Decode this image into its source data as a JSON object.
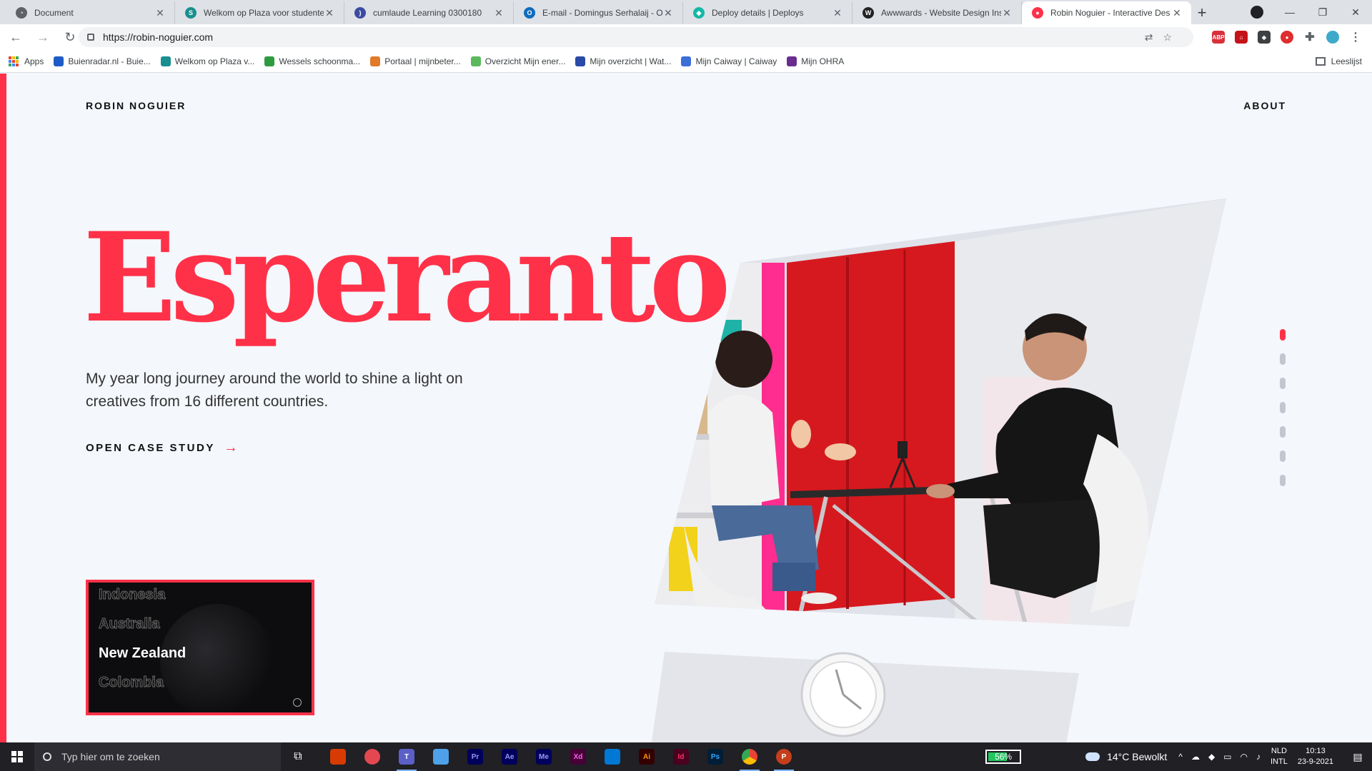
{
  "browser": {
    "tabs": [
      {
        "title": "Document",
        "fav_color": "#5f6368",
        "fav_char": "◔"
      },
      {
        "title": "Welkom op Plaza voor studente",
        "fav_color": "#1a8f8f",
        "fav_char": "S"
      },
      {
        "title": "cumlaude Learning 0300180",
        "fav_color": "#3b4ba0",
        "fav_char": ")"
      },
      {
        "title": "E-mail - Domingus Serhalaij - O",
        "fav_color": "#0f6cbd",
        "fav_char": "O"
      },
      {
        "title": "Deploy details | Deploys",
        "fav_color": "#14b8a6",
        "fav_char": "◆"
      },
      {
        "title": "Awwwards - Website Design Insp",
        "fav_color": "#222222",
        "fav_char": "W"
      },
      {
        "title": "Robin Noguier - Interactive Des",
        "fav_color": "#ff3148",
        "fav_char": "●"
      }
    ],
    "active_tab": 6,
    "new_tab_label": "+",
    "url": "https://robin-noguier.com",
    "bookmarks": [
      {
        "label": "Apps",
        "color": "#ea4335"
      },
      {
        "label": "Buienradar.nl - Buie...",
        "color": "#1e5bc6"
      },
      {
        "label": "Welkom op Plaza v...",
        "color": "#1a8f8f"
      },
      {
        "label": "Wessels schoonma...",
        "color": "#2e9b3e"
      },
      {
        "label": "Portaal | mijnbeter...",
        "color": "#e07b2a"
      },
      {
        "label": "Overzicht Mijn ener...",
        "color": "#5cb85c"
      },
      {
        "label": "Mijn overzicht | Wat...",
        "color": "#2a4aa8"
      },
      {
        "label": "Mijn Caiway | Caiway",
        "color": "#3a6fd8"
      },
      {
        "label": "Mijn OHRA",
        "color": "#6a2d8f"
      }
    ],
    "reading_list_label": "Leeslijst"
  },
  "site": {
    "brand": "ROBIN NOGUIER",
    "nav_about": "ABOUT",
    "hero_title": "Esperanto",
    "hero_subtitle": "My year long journey around the world to shine a light on creatives from 16 different countries.",
    "cta_label": "OPEN CASE STUDY",
    "accent_color": "#ff3148",
    "thumbnail": {
      "countries": [
        "Indonesia",
        "Australia",
        "New Zealand",
        "Colombia"
      ],
      "active_country": "New Zealand"
    },
    "slide_dots": {
      "count": 7,
      "active_index": 0
    }
  },
  "taskbar": {
    "search_placeholder": "Typ hier om te zoeken",
    "battery": "56%",
    "battery_level": 0.56,
    "weather": "14°C  Bewolkt",
    "lang_top": "NLD",
    "lang_bottom": "INTL",
    "time": "10:13",
    "date": "23-9-2021",
    "apps": [
      {
        "name": "office",
        "label": "",
        "bg": "#d83b01",
        "fg": "#fff"
      },
      {
        "name": "creative-cloud",
        "label": "",
        "bg": "#e34850",
        "fg": "#fff"
      },
      {
        "name": "teams",
        "label": "T",
        "bg": "#5b5fc7",
        "fg": "#fff"
      },
      {
        "name": "notepad",
        "label": "",
        "bg": "#4ea1e8",
        "fg": "#fff"
      },
      {
        "name": "premiere",
        "label": "Pr",
        "bg": "#00005b",
        "fg": "#9999ff"
      },
      {
        "name": "after-effects",
        "label": "Ae",
        "bg": "#00005b",
        "fg": "#9999ff"
      },
      {
        "name": "media-encoder",
        "label": "Me",
        "bg": "#00005b",
        "fg": "#9999ff"
      },
      {
        "name": "xd",
        "label": "Xd",
        "bg": "#470137",
        "fg": "#ff61f6"
      },
      {
        "name": "vscode",
        "label": "",
        "bg": "#0078d4",
        "fg": "#fff"
      },
      {
        "name": "illustrator",
        "label": "Ai",
        "bg": "#330000",
        "fg": "#ff9a00"
      },
      {
        "name": "indesign",
        "label": "Id",
        "bg": "#49021f",
        "fg": "#ff3366"
      },
      {
        "name": "photoshop",
        "label": "Ps",
        "bg": "#001e36",
        "fg": "#31a8ff"
      },
      {
        "name": "chrome",
        "label": "",
        "bg": "#e8eaed",
        "fg": "#fff"
      },
      {
        "name": "powerpoint",
        "label": "P",
        "bg": "#c43e1c",
        "fg": "#fff"
      }
    ]
  }
}
